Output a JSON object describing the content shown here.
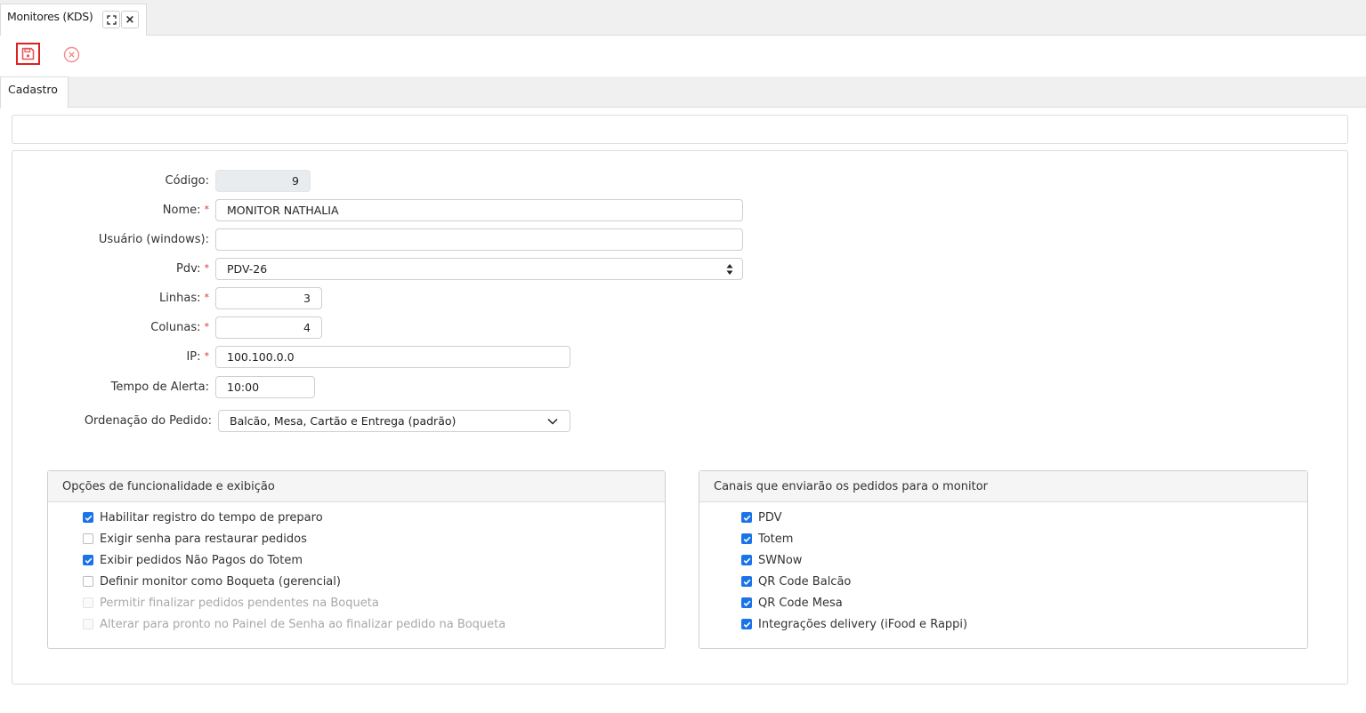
{
  "window": {
    "tab_title": "Monitores (KDS)",
    "close_glyph": "×"
  },
  "toolbar": {
    "save_icon": "save-icon",
    "cancel_icon": "cancel-icon",
    "save_color": "#e02020"
  },
  "tabs": [
    {
      "label": "Cadastro"
    }
  ],
  "form": {
    "codigo": {
      "label": "Código:",
      "value": "9"
    },
    "nome": {
      "label": "Nome:",
      "required": "*",
      "value": "MONITOR NATHALIA"
    },
    "usuario": {
      "label": "Usuário (windows):",
      "value": ""
    },
    "pdv": {
      "label": "Pdv:",
      "required": "*",
      "value": "PDV-26"
    },
    "linhas": {
      "label": "Linhas:",
      "required": "*",
      "value": "3"
    },
    "colunas": {
      "label": "Colunas:",
      "required": "*",
      "value": "4"
    },
    "ip": {
      "label": "IP:",
      "required": "*",
      "value": "100.100.0.0"
    },
    "tempo_alerta": {
      "label": "Tempo de Alerta:",
      "value": "10:00"
    },
    "ordenacao": {
      "label": "Ordenação do Pedido:",
      "value": "Balcão, Mesa, Cartão e Entrega (padrão)"
    }
  },
  "options_group": {
    "title": "Opções de funcionalidade e exibição",
    "items": [
      {
        "label": "Habilitar registro do tempo de preparo",
        "checked": true,
        "disabled": false
      },
      {
        "label": "Exigir senha para restaurar pedidos",
        "checked": false,
        "disabled": false
      },
      {
        "label": "Exibir pedidos Não Pagos do Totem",
        "checked": true,
        "disabled": false
      },
      {
        "label": "Definir monitor como Boqueta (gerencial)",
        "checked": false,
        "disabled": false
      },
      {
        "label": "Permitir finalizar pedidos pendentes na Boqueta",
        "checked": false,
        "disabled": true
      },
      {
        "label": "Alterar para pronto no Painel de Senha ao finalizar pedido na Boqueta",
        "checked": false,
        "disabled": true
      }
    ]
  },
  "channels_group": {
    "title": "Canais que enviarão os pedidos para o monitor",
    "items": [
      {
        "label": "PDV",
        "checked": true
      },
      {
        "label": "Totem",
        "checked": true
      },
      {
        "label": "SWNow",
        "checked": true
      },
      {
        "label": "QR Code Balcão",
        "checked": true
      },
      {
        "label": "QR Code Mesa",
        "checked": true
      },
      {
        "label": "Integrações delivery (iFood e Rappi)",
        "checked": true
      }
    ]
  },
  "colors": {
    "accent": "#1a73e8",
    "required": "#d33"
  }
}
